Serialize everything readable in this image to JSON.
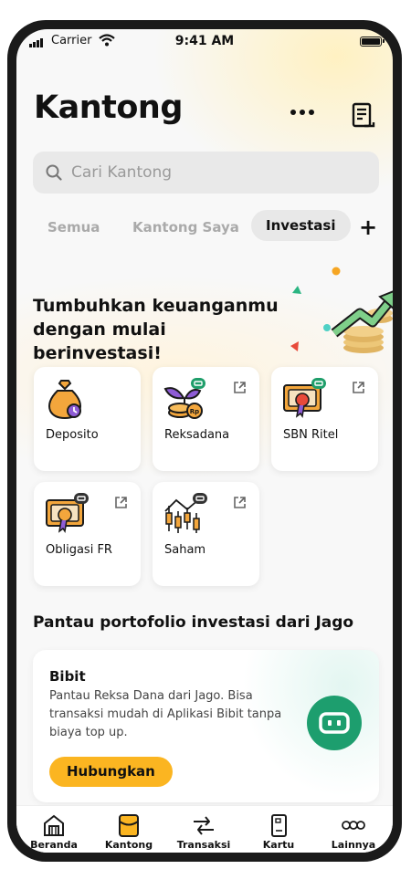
{
  "status_bar": {
    "carrier": "Carrier",
    "time": "9:41 AM"
  },
  "header": {
    "title": "Kantong"
  },
  "search": {
    "placeholder": "Cari Kantong"
  },
  "tabs": [
    {
      "label": "Semua",
      "active": false
    },
    {
      "label": "Kantong Saya",
      "active": false
    },
    {
      "label": "Investasi",
      "active": true
    }
  ],
  "hero": {
    "text": "Tumbuhkan keuanganmu dengan mulai berinvestasi!"
  },
  "products": [
    {
      "label": "Deposito",
      "external": false
    },
    {
      "label": "Reksadana",
      "external": true
    },
    {
      "label": "SBN Ritel",
      "external": true
    },
    {
      "label": "Obligasi FR",
      "external": true
    },
    {
      "label": "Saham",
      "external": true
    }
  ],
  "portfolio": {
    "title": "Pantau portofolio investasi dari Jago",
    "card_title": "Bibit",
    "card_desc": "Pantau Reksa Dana dari Jago. Bisa transaksi mudah di Aplikasi Bibit tanpa biaya top up.",
    "button": "Hubungkan"
  },
  "nav": [
    {
      "label": "Beranda",
      "icon": "home-icon"
    },
    {
      "label": "Kantong",
      "icon": "wallet-icon",
      "active": true
    },
    {
      "label": "Transaksi",
      "icon": "transfer-icon"
    },
    {
      "label": "Kartu",
      "icon": "card-icon"
    },
    {
      "label": "Lainnya",
      "icon": "more-circles-icon"
    }
  ],
  "colors": {
    "accent": "#fbb521",
    "bibit_green": "#1d9e6e",
    "badge_green": "#1f9e6a",
    "background": "#f8f8f8"
  }
}
